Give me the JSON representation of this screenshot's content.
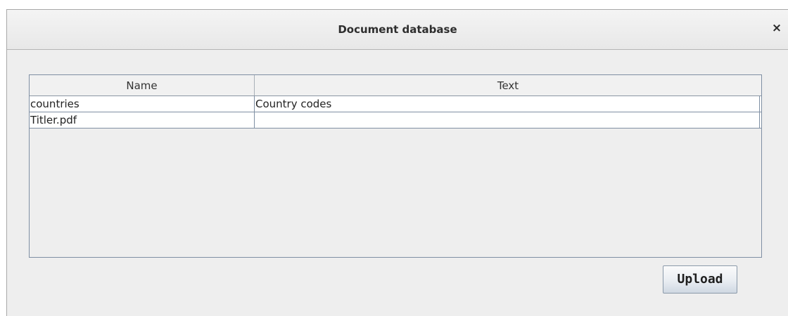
{
  "window": {
    "title": "Document database",
    "close_glyph": "×",
    "close_icon": "close-icon"
  },
  "table": {
    "columns": [
      "Name",
      "Text"
    ],
    "rows": [
      {
        "name": "countries",
        "text": "Country codes"
      },
      {
        "name": "Titler.pdf",
        "text": ""
      }
    ]
  },
  "actions": {
    "upload_label": "Upload"
  },
  "colors": {
    "window_bg": "#eeeeee",
    "table_border": "#7f8fa3",
    "row_bg": "#ffffff"
  }
}
